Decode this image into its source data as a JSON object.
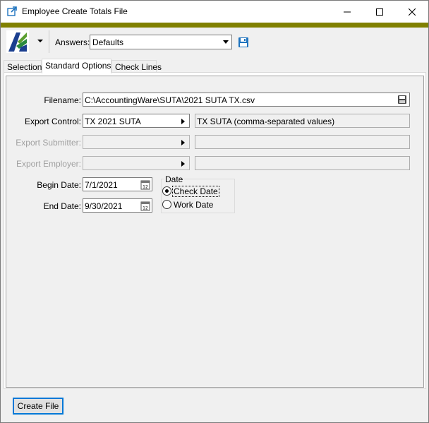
{
  "window": {
    "title": "Employee Create Totals File"
  },
  "toolbar": {
    "answers_label": "Answers:",
    "answers_value": "Defaults"
  },
  "tabs": [
    {
      "label": "Selection",
      "active": false
    },
    {
      "label": "Standard Options",
      "active": true
    },
    {
      "label": "Check Lines",
      "active": false
    }
  ],
  "form": {
    "filename_label": "Filename:",
    "filename_value": "C:\\AccountingWare\\SUTA\\2021 SUTA TX.csv",
    "export_control_label": "Export Control:",
    "export_control_value": "TX 2021 SUTA",
    "export_control_desc": "TX SUTA (comma-separated values)",
    "export_submitter_label": "Export Submitter:",
    "export_submitter_value": "",
    "export_submitter_desc": "",
    "export_employer_label": "Export Employer:",
    "export_employer_value": "",
    "export_employer_desc": "",
    "begin_date_label": "Begin Date:",
    "begin_date_value": "7/1/2021",
    "end_date_label": "End Date:",
    "end_date_value": "9/30/2021",
    "date_group_label": "Date",
    "date_options": [
      {
        "label": "Check Date",
        "selected": true
      },
      {
        "label": "Work Date",
        "selected": false
      }
    ]
  },
  "footer": {
    "create_file_label": "Create File"
  },
  "colors": {
    "accent_bar": "#808000",
    "focus_blue": "#0078d7"
  },
  "icons": [
    "external-link-icon",
    "minimize-icon",
    "maximize-icon",
    "close-icon",
    "app-logo",
    "chevron-down-icon",
    "save-icon",
    "folder-icon",
    "calendar-icon"
  ]
}
